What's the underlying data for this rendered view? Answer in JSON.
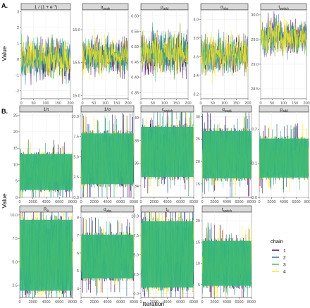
{
  "colors": {
    "chain1": "#440154",
    "chain2": "#31688e",
    "chain3": "#35b779",
    "chain4": "#fde725",
    "panel_bg": "#ffffff",
    "grid": "#ebebeb",
    "strip_bg": "#d9d9d9",
    "border": "#333333"
  },
  "labels": {
    "ylabel": "Value",
    "xlabel": "Iteration",
    "legend_title": "chain"
  },
  "chart_data": [
    {
      "type": "line",
      "row_label": "A.",
      "x_ticks": [
        "0",
        "50",
        "100",
        "150",
        "200"
      ],
      "xlim": [
        0,
        200
      ],
      "chains": [
        "1",
        "2",
        "3",
        "4"
      ],
      "panels": [
        {
          "title": "1 / (1 + e^(−x))",
          "title_main": "1 / (1 + e",
          "title_sup": "−τ",
          "title_end": ")",
          "ylim": [
            -2.5,
            3.1
          ],
          "y_ticks": [
            "-2",
            "-1",
            "0",
            "1",
            "2",
            "3"
          ],
          "y_tick_values": [
            -2,
            -1,
            0,
            1,
            2,
            3
          ],
          "center": 0.0,
          "spread": 0.9
        },
        {
          "title": "α_peak",
          "title_main": "α",
          "title_sub": "peak",
          "ylim": [
            14.95,
            16.3
          ],
          "y_ticks": [
            "15.0",
            "15.5",
            "16.0"
          ],
          "y_tick_values": [
            15.0,
            15.5,
            16.0
          ],
          "center": 15.6,
          "spread": 0.2
        },
        {
          "title": "ρ_add",
          "title_main": "ρ",
          "title_sub": "add",
          "ylim": [
            0.33,
            0.62
          ],
          "y_ticks": [
            "0.35",
            "0.40",
            "0.45",
            "0.50",
            "0.55",
            "0.60"
          ],
          "y_tick_values": [
            0.35,
            0.4,
            0.45,
            0.5,
            0.55,
            0.6
          ],
          "center": 0.48,
          "spread": 0.05
        },
        {
          "title": "σ_obs",
          "title_main": "σ",
          "title_sub": "obs",
          "ylim": [
            3.15,
            4.1
          ],
          "y_ticks": [
            "3.2",
            "3.4",
            "3.6",
            "3.8",
            "4.0"
          ],
          "y_tick_values": [
            3.2,
            3.4,
            3.6,
            3.8,
            4.0
          ],
          "center": 3.62,
          "spread": 0.15
        },
        {
          "title": "t_switch",
          "title_main": "t",
          "title_sub": "switch",
          "ylim": [
            28.3,
            30.1
          ],
          "y_ticks": [
            "28.5",
            "29.0",
            "29.5",
            "30.0"
          ],
          "y_tick_values": [
            28.5,
            29.0,
            29.5,
            30.0
          ],
          "center": 29.55,
          "spread": 0.25
        }
      ]
    },
    {
      "type": "line",
      "row_label": "B.",
      "x_ticks": [
        "0",
        "2000",
        "4000",
        "6000",
        "8000"
      ],
      "xlim": [
        0,
        8000
      ],
      "chains": [
        "1",
        "2",
        "3",
        "4"
      ],
      "panels": [
        {
          "title": "1/τ",
          "title_main": "1/τ",
          "ylim": [
            0,
            26
          ],
          "y_ticks": [
            "0",
            "5",
            "10",
            "15",
            "20",
            "25"
          ],
          "y_tick_values": [
            0,
            5,
            10,
            15,
            20,
            25
          ],
          "band": [
            1.5,
            14
          ]
        },
        {
          "title": "1/σ",
          "title_main": "1/σ",
          "ylim": [
            0,
            10.5
          ],
          "y_ticks": [
            "0.0",
            "2.5",
            "5.0",
            "7.5",
            "10.0"
          ],
          "y_tick_values": [
            0,
            2.5,
            5,
            7.5,
            10
          ],
          "band": [
            1.2,
            8.3
          ]
        },
        {
          "title": "c_switch",
          "title_main": "c",
          "title_sub": "switch",
          "ylim": [
            33,
            40.5
          ],
          "y_ticks": [
            "34",
            "36",
            "38",
            "40"
          ],
          "y_tick_values": [
            34,
            36,
            38,
            40
          ],
          "band": [
            34.5,
            39.5
          ]
        },
        {
          "title": "α_peak",
          "title_main": "α",
          "title_sub": "peak",
          "ylim": [
            12,
            31
          ],
          "y_ticks": [
            "15",
            "20",
            "25",
            "30"
          ],
          "y_tick_values": [
            15,
            20,
            25,
            30
          ],
          "band": [
            15.5,
            27.5
          ]
        },
        {
          "title": "ρ_add",
          "title_main": "ρ",
          "title_sub": "add",
          "ylim": [
            0,
            0.25
          ],
          "y_ticks": [
            "0.0",
            "0.1",
            "0.2"
          ],
          "y_tick_values": [
            0,
            0.1,
            0.2
          ],
          "band": [
            0.05,
            0.18
          ]
        },
        {
          "title": "R₀",
          "title_main": "R",
          "title_sub": "0",
          "ylim": [
            1.2,
            10.3
          ],
          "y_ticks": [
            "2.5",
            "5.0",
            "7.5",
            "10.0"
          ],
          "y_tick_values": [
            2.5,
            5,
            7.5,
            10
          ],
          "band": [
            1.4,
            10.0
          ]
        },
        {
          "title": "σ_obs",
          "title_main": "σ",
          "title_sub": "obs",
          "ylim": [
            3.5,
            8.3
          ],
          "y_ticks": [
            "4",
            "5",
            "6",
            "7",
            "8"
          ],
          "y_tick_values": [
            4,
            5,
            6,
            7,
            8
          ],
          "band": [
            4.4,
            7.2
          ]
        },
        {
          "title": "t₀",
          "title_main": "t",
          "title_sub": "0",
          "ylim": [
            -0.5,
            10.5
          ],
          "y_ticks": [
            "0.0",
            "2.5",
            "5.0",
            "7.5",
            "10.0"
          ],
          "y_tick_values": [
            0,
            2.5,
            5,
            7.5,
            10
          ],
          "band": [
            0.2,
            9.9
          ]
        },
        {
          "title": "t_switch",
          "title_main": "t",
          "title_sub": "switch",
          "ylim": [
            2,
            22
          ],
          "y_ticks": [
            "5",
            "10",
            "15",
            "20"
          ],
          "y_tick_values": [
            5,
            10,
            15,
            20
          ],
          "band": [
            4,
            16
          ]
        }
      ]
    }
  ]
}
